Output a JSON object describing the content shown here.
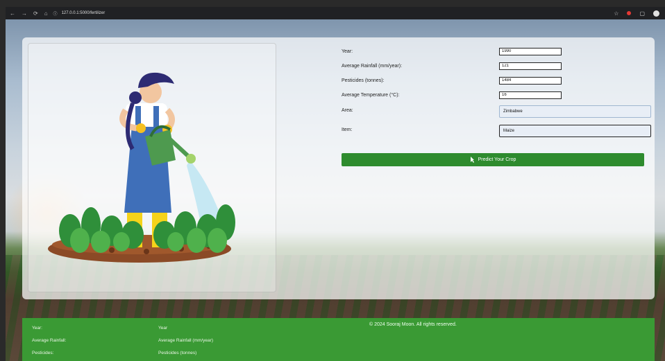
{
  "browser": {
    "back": "←",
    "forward": "→",
    "reload": "⟳",
    "home": "⌂",
    "url": "127.0.0.1:5000/fertilizer"
  },
  "form": {
    "year_label": "Year:",
    "year_value": "1990",
    "rainfall_label": "Average Rainfall (mm/year):",
    "rainfall_value": "121",
    "pesticides_label": "Pesticides (tonnes):",
    "pesticides_value": "1484",
    "temperature_label": "Average Temperature (°C):",
    "temperature_value": "16",
    "area_label": "Area:",
    "area_value": "Zimbabwe",
    "item_label": "Item:",
    "item_value": "Maize",
    "submit_label": "Predict Your Crop"
  },
  "footer": {
    "left_labels": [
      "Year:",
      "Average Rainfall:",
      "Pesticides:"
    ],
    "right_labels": [
      "Year",
      "Average Rainfall (mm/year)",
      "Pesticides (tonnes)"
    ],
    "copyright": "© 2024 Sooraj Moon. All rights reserved."
  },
  "colors": {
    "primary_green": "#2e8b2e",
    "footer_green": "#3a9a34"
  },
  "icons": [
    "back-icon",
    "forward-icon",
    "reload-icon",
    "home-icon",
    "site-info-icon",
    "star-icon",
    "extension-icon",
    "puzzle-icon",
    "profile-icon",
    "gardener-illustration",
    "cursor-icon"
  ]
}
